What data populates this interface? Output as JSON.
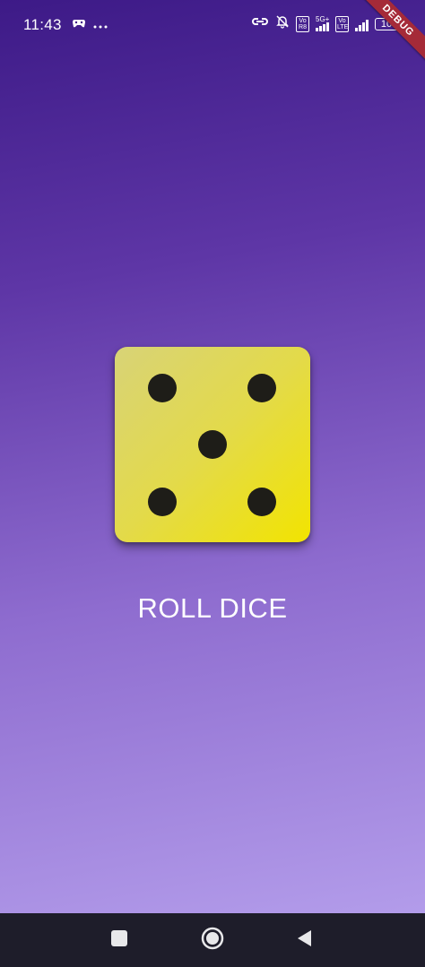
{
  "status_bar": {
    "time": "11:43",
    "net_label": "5G+",
    "volte_badge_1": "Vo\nR8",
    "volte_badge_2": "Vo\nLTE",
    "battery_level": "10"
  },
  "debug_banner": "DEBUG",
  "dice": {
    "face_value": 5,
    "color": "#e6dc3c"
  },
  "roll_button": {
    "label": "ROLL DICE"
  },
  "nav_bar": {
    "items": [
      "recents-button",
      "home-button",
      "back-button"
    ]
  },
  "colors": {
    "gradient_top": "#3d1a87",
    "gradient_bottom": "#b8a3ee",
    "nav_background": "#1e1d2a"
  }
}
